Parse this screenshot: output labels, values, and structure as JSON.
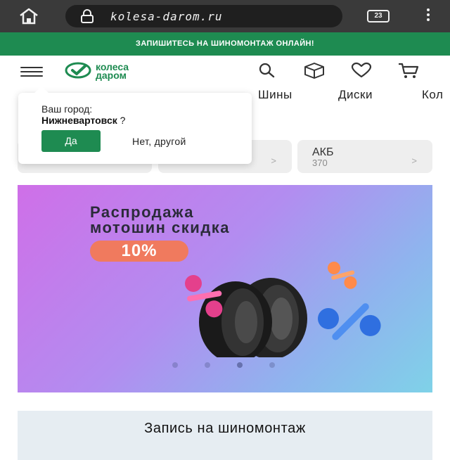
{
  "browser": {
    "url": "kolesa-darom.ru",
    "tab_count": "23"
  },
  "promo": {
    "text": "ЗАПИШИТЕСЬ НА ШИНОМОНТАЖ ОНЛАЙН!"
  },
  "logo": {
    "line1": "колеса",
    "line2": "даром"
  },
  "categories": {
    "tabs": [
      "Шины",
      "Диски",
      "Кол"
    ]
  },
  "cards": [
    {
      "title": "",
      "count": ""
    },
    {
      "title": "",
      "count": ""
    },
    {
      "title": "АКБ",
      "count": "370"
    }
  ],
  "city_popup": {
    "label": "Ваш город:",
    "city": "Нижневартовск",
    "question": " ?",
    "yes": "Да",
    "no": "Нет, другой"
  },
  "banner": {
    "line1": "Распродажа",
    "line2": "мотошин скидка",
    "discount": "10%",
    "slides": 4,
    "active_slide": 3
  },
  "signup": {
    "title": "Запись на шиномонтаж"
  },
  "colors": {
    "brand_green": "#1e8b51",
    "promo_badge": "#f07a5e"
  }
}
